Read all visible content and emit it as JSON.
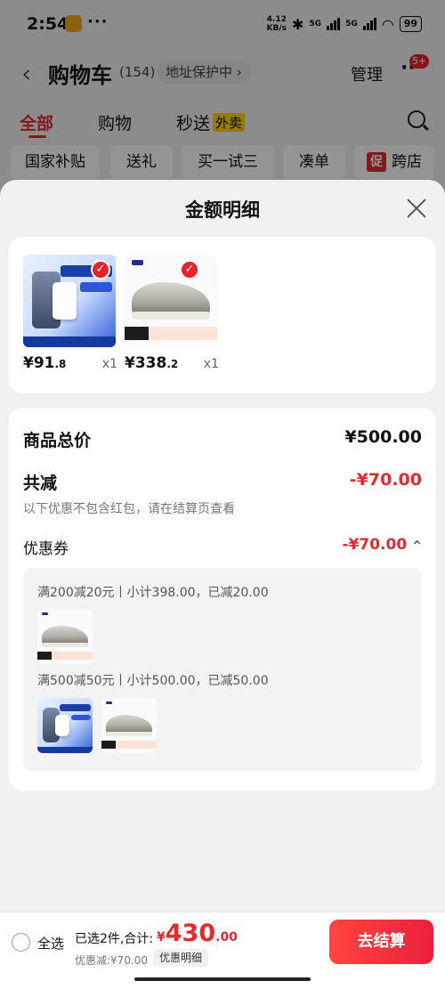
{
  "status_bar": {
    "time": "2:54",
    "dots": "···",
    "net_speed_top": "4.12",
    "net_speed_bottom": "KB/s",
    "sig1": "5G",
    "sig2": "5G",
    "battery": "99"
  },
  "header": {
    "title": "购物车",
    "count": "(154)",
    "address_protect": "地址保护中 ›",
    "manage": "管理",
    "badge": "5+"
  },
  "tabs": [
    {
      "label": "全部",
      "active": true
    },
    {
      "label": "购物"
    },
    {
      "label": "秒送"
    },
    {
      "label": "外卖"
    }
  ],
  "chips": [
    {
      "label": "国家补贴"
    },
    {
      "label": "送礼"
    },
    {
      "label": "买一试三"
    },
    {
      "label": "凑单"
    },
    {
      "label": "跨店",
      "tag": "促"
    }
  ],
  "sheet": {
    "title": "金额明细",
    "products": [
      {
        "price_int": "¥91",
        "price_dec": ".8",
        "qty": "x1"
      },
      {
        "price_int": "¥338",
        "price_dec": ".2",
        "qty": "x1"
      }
    ],
    "total_label": "商品总价",
    "total_value": "¥500.00",
    "reduce_label": "共减",
    "reduce_value": "-¥70.00",
    "reduce_note": "以下优惠不包含红包，请在结算页查看",
    "coupon_label": "优惠券",
    "coupon_value": "-¥70.00",
    "coupon_caret": "^",
    "coupon_rules": [
      {
        "text": "满200减20元丨小计398.00，已减20.00"
      },
      {
        "text": "满500减50元丨小计500.00，已减50.00"
      }
    ]
  },
  "bottom": {
    "select_all": "全选",
    "summary": "已选2件,合计:",
    "total_cur": "¥",
    "total_int": "430",
    "total_dec": ".00",
    "saved": "优惠减:¥70.00",
    "detail": "优惠明细",
    "checkout": "去结算"
  },
  "colors": {
    "accent": "#e4292f",
    "sheet_bg": "#f1f1f1"
  }
}
